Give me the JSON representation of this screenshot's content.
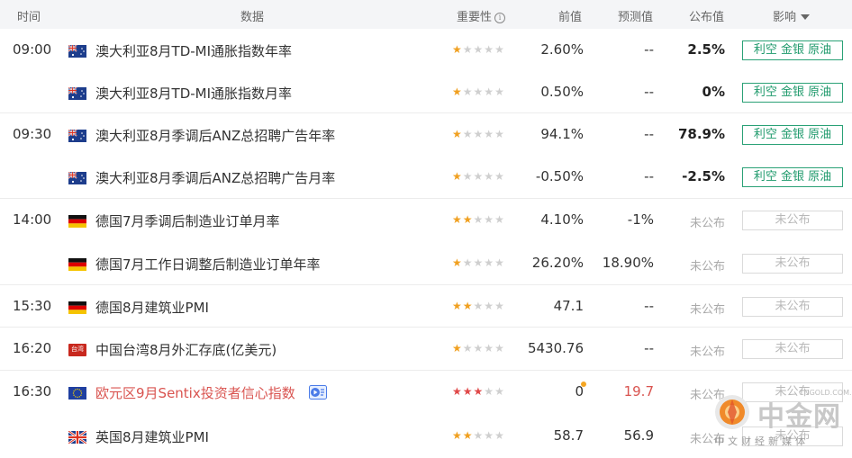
{
  "header": {
    "time": "时间",
    "data": "数据",
    "importance": "重要性",
    "importance_icon": "i",
    "previous": "前值",
    "forecast": "预测值",
    "actual": "公布值",
    "impact": "影响"
  },
  "rows": [
    {
      "time": "09:00",
      "flag": "australia-flag",
      "name": "澳大利亚8月TD-MI通胀指数年率",
      "stars": 1,
      "previous": "2.60%",
      "forecast": "--",
      "actual": "2.5%",
      "impact": "利空 金银 原油"
    },
    {
      "time": "",
      "flag": "australia-flag",
      "name": "澳大利亚8月TD-MI通胀指数月率",
      "stars": 1,
      "previous": "0.50%",
      "forecast": "--",
      "actual": "0%",
      "impact": "利空 金银 原油"
    },
    {
      "time": "09:30",
      "flag": "australia-flag",
      "name": "澳大利亚8月季调后ANZ总招聘广告年率",
      "stars": 1,
      "previous": "94.1%",
      "forecast": "--",
      "actual": "78.9%",
      "impact": "利空 金银 原油"
    },
    {
      "time": "",
      "flag": "australia-flag",
      "name": "澳大利亚8月季调后ANZ总招聘广告月率",
      "stars": 1,
      "previous": "-0.50%",
      "forecast": "--",
      "actual": "-2.5%",
      "impact": "利空 金银 原油"
    },
    {
      "time": "14:00",
      "flag": "germany-flag",
      "name": "德国7月季调后制造业订单月率",
      "stars": 2,
      "previous": "4.10%",
      "forecast": "-1%",
      "actual": "未公布",
      "impact": "未公布"
    },
    {
      "time": "",
      "flag": "germany-flag",
      "name": "德国7月工作日调整后制造业订单年率",
      "stars": 1,
      "previous": "26.20%",
      "forecast": "18.90%",
      "actual": "未公布",
      "impact": "未公布"
    },
    {
      "time": "15:30",
      "flag": "germany-flag",
      "name": "德国8月建筑业PMI",
      "stars": 2,
      "previous": "47.1",
      "forecast": "--",
      "actual": "未公布",
      "impact": "未公布"
    },
    {
      "time": "16:20",
      "flag": "taiwan-flag",
      "flag_text": "台湾",
      "name": "中国台湾8月外汇存底(亿美元)",
      "stars": 1,
      "previous": "5430.76",
      "forecast": "--",
      "actual": "未公布",
      "impact": "未公布"
    },
    {
      "time": "16:30",
      "flag": "eu-flag",
      "name": "欧元区9月Sentix投资者信心指数",
      "stars": 3,
      "previous": "0",
      "forecast": "19.7",
      "actual": "未公布",
      "impact": "未公布"
    },
    {
      "time": "",
      "flag": "uk-flag",
      "name": "英国8月建筑业PMI",
      "stars": 2,
      "previous": "58.7",
      "forecast": "56.9",
      "actual": "未公布",
      "impact": "未公布"
    }
  ],
  "watermark": {
    "name": "中金网",
    "url": "CNGOLD.COM.CN",
    "tagline": "中文财经新媒体"
  },
  "colors": {
    "header_bg": "#f4f5f7",
    "star_on": "#f0a020",
    "star_high": "#e04848",
    "impact_green": "#1f9a6c",
    "highlight_red": "#d9534f"
  }
}
